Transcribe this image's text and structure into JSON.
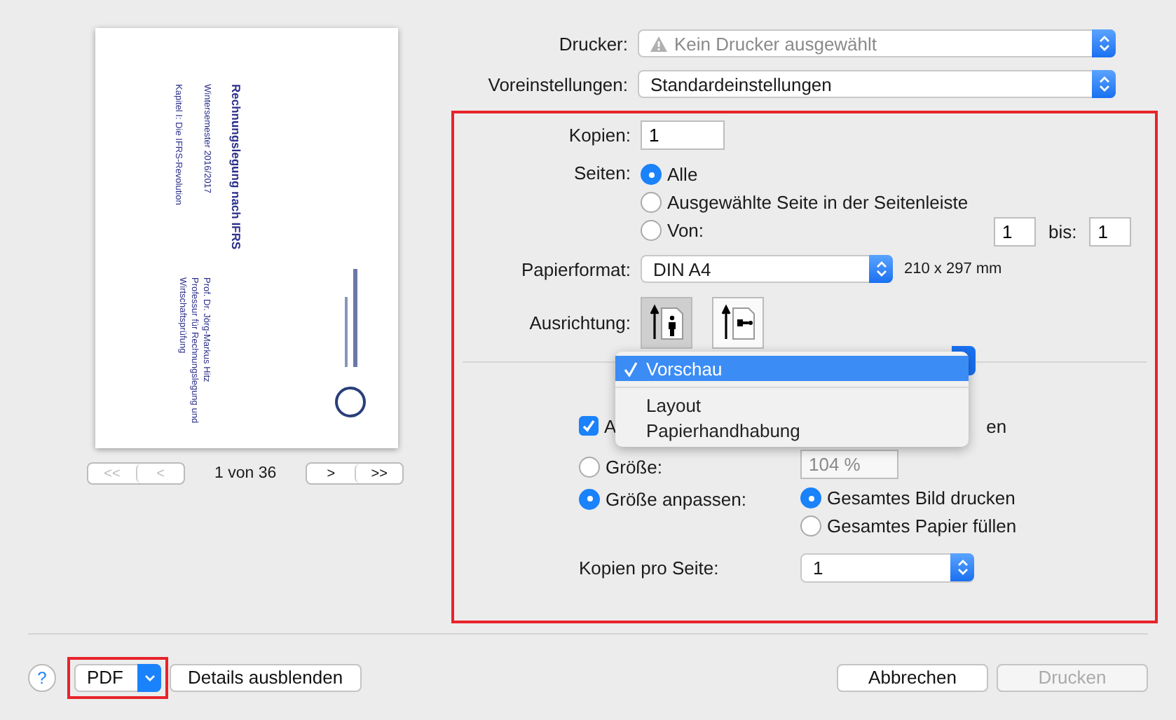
{
  "preview": {
    "page_texts": [
      {
        "kind": "title",
        "text": "Rechnungslegung nach IFRS"
      },
      {
        "kind": "subtitle",
        "text": "Wintersemester 2016/2017"
      },
      {
        "kind": "chapter",
        "text": "Kapitel I: Die IFRS-Revolution"
      },
      {
        "kind": "author",
        "text": "Prof. Dr. Jörg-Markus Hitz"
      },
      {
        "kind": "author",
        "text": "Professur für Rechnungslegung und"
      },
      {
        "kind": "author",
        "text": "Wirtschaftsprüfung"
      }
    ],
    "nav_buttons": [
      {
        "label": "<<",
        "disabled": true
      },
      {
        "label": "<",
        "disabled": true
      },
      {
        "label": ">",
        "disabled": false
      },
      {
        "label": ">>",
        "disabled": false
      }
    ],
    "page_indicator": "1 von 36"
  },
  "printer": {
    "label": "Drucker:",
    "value": "Kein Drucker ausgewählt",
    "disabled": true
  },
  "presets": {
    "label": "Voreinstellungen:",
    "value": "Standardeinstellungen"
  },
  "options_panel": {
    "highlighted": true,
    "copies": {
      "label": "Kopien:",
      "value": "1"
    },
    "pages": {
      "label": "Seiten:",
      "options": [
        {
          "label": "Alle",
          "selected": true
        },
        {
          "label": "Ausgewählte Seite in der Seitenleiste",
          "selected": false
        },
        {
          "label": "Von:",
          "selected": false
        }
      ],
      "from": "1",
      "to_label": "bis:",
      "to": "1"
    },
    "paper_size": {
      "label": "Papierformat:",
      "value": "DIN A4",
      "dimensions": "210 x 297 mm"
    },
    "orientation": {
      "label": "Ausrichtung:",
      "options": [
        {
          "kind": "portrait",
          "selected": true
        },
        {
          "kind": "landscape",
          "selected": false
        }
      ]
    },
    "menu": {
      "items": [
        {
          "label": "Vorschau",
          "selected": true
        },
        {
          "label": "Layout",
          "selected": false
        },
        {
          "label": "Papierhandhabung",
          "selected": false
        }
      ]
    },
    "auto_rotate": {
      "checked": true,
      "label_start": "A",
      "label_end": "en"
    },
    "scale": {
      "options": [
        {
          "label": "Größe:",
          "selected": false
        },
        {
          "label": "Größe anpassen:",
          "selected": true
        }
      ],
      "value": "104 %",
      "fit_options": [
        {
          "label": "Gesamtes Bild drucken",
          "selected": true
        },
        {
          "label": "Gesamtes Papier füllen",
          "selected": false
        }
      ]
    },
    "pages_per_sheet": {
      "label": "Kopien pro Seite:",
      "value": "1"
    }
  },
  "footer": {
    "help": "?",
    "pdf": {
      "label": "PDF",
      "highlighted": true
    },
    "details": "Details ausblenden",
    "cancel": "Abbrechen",
    "print": {
      "label": "Drucken",
      "disabled": true
    }
  }
}
